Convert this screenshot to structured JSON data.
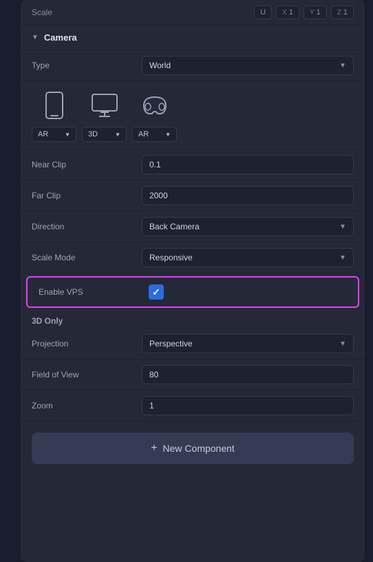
{
  "scale_row": {
    "label": "Scale",
    "icon": "U",
    "x_label": "X",
    "x_value": "1",
    "y_label": "Y",
    "y_value": "1",
    "z_label": "Z",
    "z_value": "1"
  },
  "camera_section": {
    "title": "Camera",
    "chevron": "▼"
  },
  "type_row": {
    "label": "Type",
    "value": "World"
  },
  "devices": [
    {
      "icon": "📱",
      "label": "AR"
    },
    {
      "icon": "🖥",
      "label": "3D"
    },
    {
      "icon": "🥽",
      "label": "AR"
    }
  ],
  "near_clip": {
    "label": "Near Clip",
    "value": "0.1"
  },
  "far_clip": {
    "label": "Far Clip",
    "value": "2000"
  },
  "direction": {
    "label": "Direction",
    "value": "Back Camera"
  },
  "scale_mode": {
    "label": "Scale Mode",
    "value": "Responsive"
  },
  "enable_vps": {
    "label": "Enable VPS",
    "checked": true
  },
  "sublabel_3d": "3D Only",
  "projection": {
    "label": "Projection",
    "value": "Perspective"
  },
  "field_of_view": {
    "label": "Field of View",
    "value": "80"
  },
  "zoom": {
    "label": "Zoom",
    "value": "1"
  },
  "new_component": {
    "label": "New Component",
    "plus": "+"
  }
}
